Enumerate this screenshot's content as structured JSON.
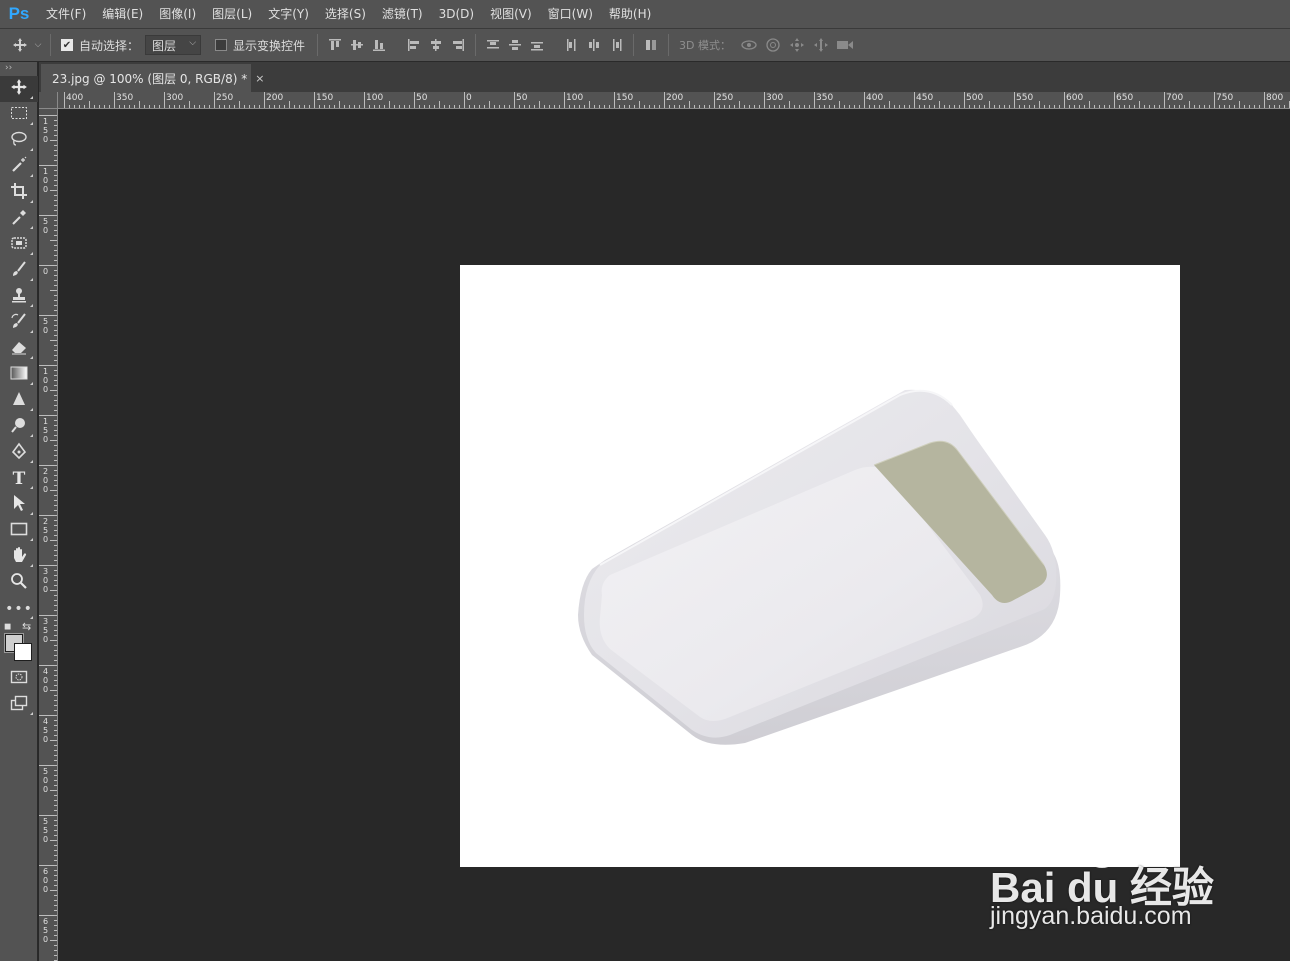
{
  "app": {
    "logo": "Ps",
    "accent": "#31a8ff"
  },
  "menu": [
    "文件(F)",
    "编辑(E)",
    "图像(I)",
    "图层(L)",
    "文字(Y)",
    "选择(S)",
    "滤镜(T)",
    "3D(D)",
    "视图(V)",
    "窗口(W)",
    "帮助(H)"
  ],
  "options": {
    "auto_select_label": "自动选择：",
    "auto_select_checked": true,
    "auto_select_target": "图层",
    "show_transform_label": "显示变换控件",
    "show_transform_checked": false,
    "mode_3d_label": "3D 模式："
  },
  "document": {
    "tab_title": "23.jpg @ 100% (图层 0, RGB/8) *",
    "close_glyph": "×",
    "canvas_color": "#ffffff"
  },
  "ruler": {
    "top_labels": [
      "400",
      "350",
      "300",
      "250",
      "200",
      "150",
      "100",
      "50",
      "0",
      "50",
      "100",
      "150",
      "200",
      "250",
      "300",
      "350",
      "400",
      "450",
      "500",
      "550",
      "600",
      "650",
      "700",
      "750",
      "800"
    ],
    "left_labels": [
      "150",
      "100",
      "50",
      "0",
      "50",
      "100",
      "150",
      "200",
      "250",
      "300",
      "350",
      "400",
      "450",
      "500",
      "550",
      "600",
      "650"
    ]
  },
  "tools": [
    "move-tool-icon",
    "marquee-tool-icon",
    "lasso-tool-icon",
    "magic-wand-tool-icon",
    "crop-tool-icon",
    "eyedropper-tool-icon",
    "healing-brush-tool-icon",
    "brush-tool-icon",
    "clone-stamp-tool-icon",
    "history-brush-tool-icon",
    "eraser-tool-icon",
    "gradient-tool-icon",
    "blur-tool-icon",
    "dodge-tool-icon",
    "pen-tool-icon",
    "type-tool-icon",
    "path-selection-tool-icon",
    "rectangle-tool-icon",
    "hand-tool-icon",
    "zoom-tool-icon",
    "more-tools-icon"
  ],
  "colors": {
    "foreground": "#cfcfcf",
    "background": "#ffffff"
  },
  "watermark": {
    "brand": "Bai du 经验",
    "url": "jingyan.baidu.com"
  }
}
